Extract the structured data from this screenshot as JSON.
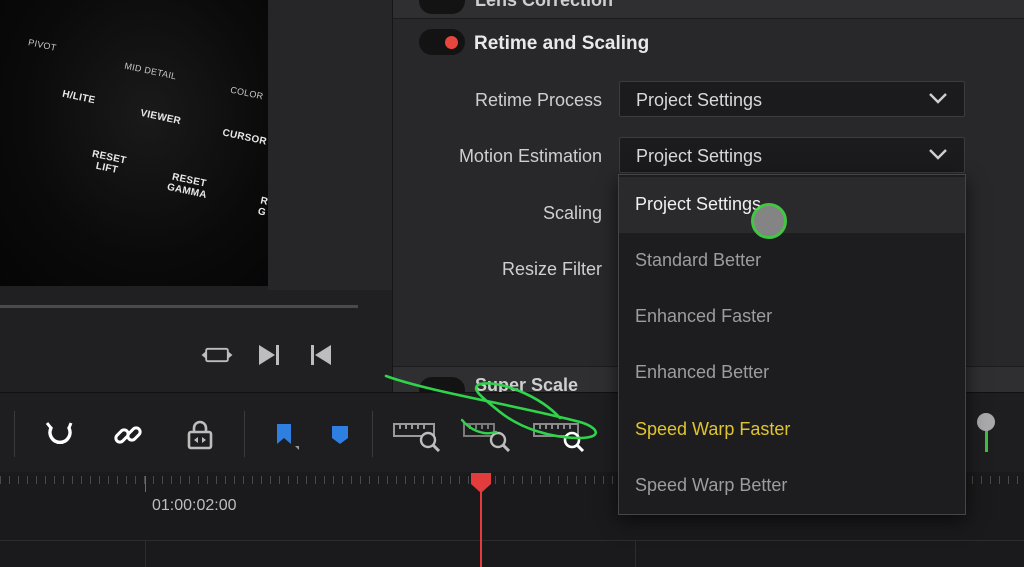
{
  "viewer": {
    "keys": {
      "pivot": "PIVOT",
      "mid_detail": "MID DETAIL",
      "color": "COLOR",
      "hlite": "H/LITE",
      "viewer": "VIEWER",
      "cursor": "CURSOR",
      "reset_lift": "RESET LIFT",
      "reset_gamma": "RESET GAMMA",
      "partial": "R G"
    },
    "transport_icons": [
      "loop-icon",
      "skip-forward-icon",
      "skip-backward-icon"
    ]
  },
  "inspector": {
    "lens_correction_label": "Lens Correction",
    "retime_section": {
      "title": "Retime and Scaling",
      "enabled": true,
      "toggle_color": "#e8453c"
    },
    "rows": [
      {
        "label": "Retime Process",
        "value": "Project Settings"
      },
      {
        "label": "Motion Estimation",
        "value": "Project Settings"
      },
      {
        "label": "Scaling",
        "value": ""
      },
      {
        "label": "Resize Filter",
        "value": ""
      }
    ],
    "super_scale_label": "Super Scale"
  },
  "dropdown": {
    "options": [
      {
        "label": "Project Settings",
        "selected": true
      },
      {
        "label": "Standard Better",
        "selected": false
      },
      {
        "label": "Enhanced Faster",
        "selected": false
      },
      {
        "label": "Enhanced Better",
        "selected": false
      },
      {
        "label": "Speed Warp Faster",
        "selected": false,
        "highlighted": true
      },
      {
        "label": "Speed Warp Better",
        "selected": false
      }
    ]
  },
  "toolbar": {
    "icons": [
      "snapping-magnet-icon",
      "linked-selection-icon",
      "position-lock-icon",
      "flag-icon",
      "marker-icon",
      "zoom-full-icon",
      "zoom-detail-icon",
      "zoom-custom-icon"
    ],
    "accent": "#2f7fe0"
  },
  "timeline": {
    "timecode": "01:00:02:00",
    "playhead_color": "#e23c3c",
    "zoom_slider_color": "#3fbf3f"
  },
  "annotation_color": "#2fd44a"
}
